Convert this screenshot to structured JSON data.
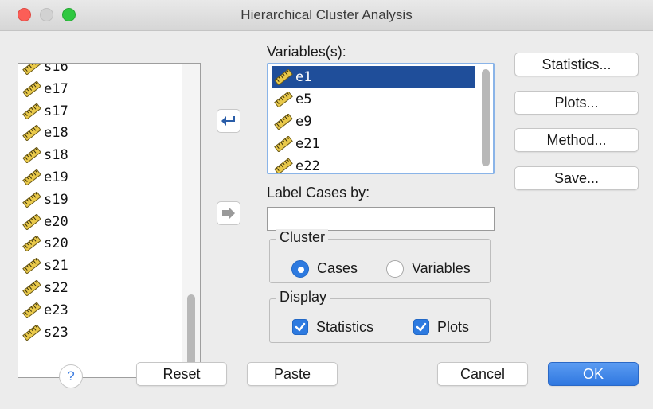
{
  "window": {
    "title": "Hierarchical Cluster Analysis"
  },
  "source_list": {
    "items": [
      "s16",
      "e17",
      "s17",
      "e18",
      "s18",
      "e19",
      "s19",
      "e20",
      "s20",
      "s21",
      "s22",
      "e23",
      "s23"
    ]
  },
  "variables": {
    "label": "Variables(s):",
    "items": [
      "e1",
      "e5",
      "e9",
      "e21",
      "e22"
    ],
    "selected": "e1"
  },
  "label_cases": {
    "label": "Label Cases by:",
    "value": ""
  },
  "cluster": {
    "title": "Cluster",
    "options": [
      "Cases",
      "Variables"
    ],
    "selected": "Cases"
  },
  "display": {
    "title": "Display",
    "statistics_label": "Statistics",
    "statistics_checked": true,
    "plots_label": "Plots",
    "plots_checked": true
  },
  "side_buttons": {
    "statistics": "Statistics...",
    "plots": "Plots...",
    "method": "Method...",
    "save": "Save..."
  },
  "footer": {
    "help": "?",
    "reset": "Reset",
    "paste": "Paste",
    "cancel": "Cancel",
    "ok": "OK"
  },
  "colors": {
    "selection": "#1f4e9a",
    "accent": "#2d7ae0",
    "close": "#fc5e57",
    "maximize": "#2fc840"
  },
  "icons": {
    "variable_item": "ruler-scale-icon",
    "move_left": "arrow-left-icon",
    "move_right": "arrow-right-icon"
  }
}
